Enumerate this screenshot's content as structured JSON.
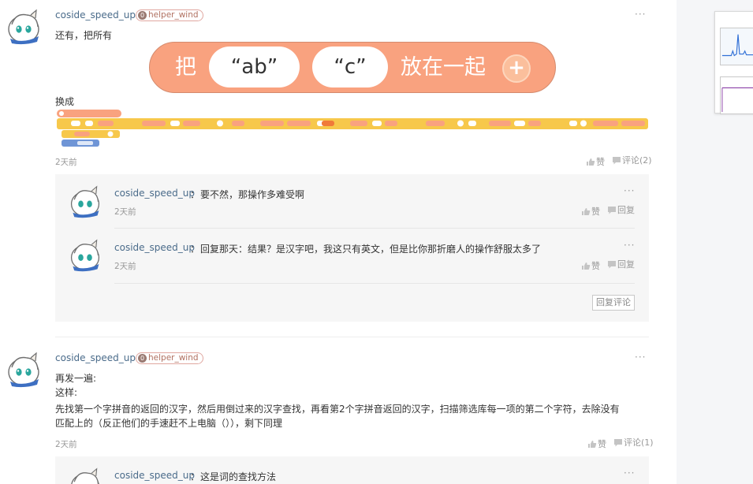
{
  "colors": {
    "link": "#4a6b8a",
    "block_orange": "#f9a27f",
    "block_yellow": "#f7c84b",
    "block_blue": "#6f95d6",
    "reply_bg": "#f6f6f6"
  },
  "icons": {
    "more": "more-dots-icon",
    "like": "thumb-up-icon",
    "comment": "comment-bubble-icon"
  },
  "posts": [
    {
      "username": "coside_speed_up",
      "badge_level": "0",
      "badge_label": "helper_wind",
      "line1": "还有，把所有",
      "block": {
        "verb": "把",
        "slot1": "“ab”",
        "slot2": "“c”",
        "tail": "放在一起",
        "plus": "+"
      },
      "line2": "换成",
      "time": "2天前",
      "like_label": "赞",
      "comment_label": "评论(2)",
      "more": "···",
      "replies": [
        {
          "username": "coside_speed_up",
          "sep": "：",
          "text": "要不然，那操作多难受啊",
          "time": "2天前",
          "like_label": "赞",
          "reply_label": "回复",
          "more": "···"
        },
        {
          "username": "coside_speed_up",
          "sep": "：",
          "text": "回复那天：结果？是汉字吧，我这只有英文，但是比你那折磨人的操作舒服太多了",
          "time": "2天前",
          "like_label": "赞",
          "reply_label": "回复",
          "more": "···"
        }
      ],
      "reply_button": "回复评论"
    },
    {
      "username": "coside_speed_up",
      "badge_level": "0",
      "badge_label": "helper_wind",
      "lines": [
        "再发一遍:",
        "这样:",
        "先找第一个字拼音的返回的汉字，然后用倒过来的汉字查找，再看第2个字拼音返回的汉字，扫描筛选库每一项的第二个字符，去除没有",
        "匹配上的（反正他们的手速赶不上电脑（）），剩下同理"
      ],
      "time": "2天前",
      "like_label": "赞",
      "comment_label": "评论(1)",
      "more": "···",
      "replies": [
        {
          "username": "coside_speed_up",
          "sep": "：",
          "text": "这是词的查找方法",
          "more": "···"
        }
      ]
    }
  ]
}
